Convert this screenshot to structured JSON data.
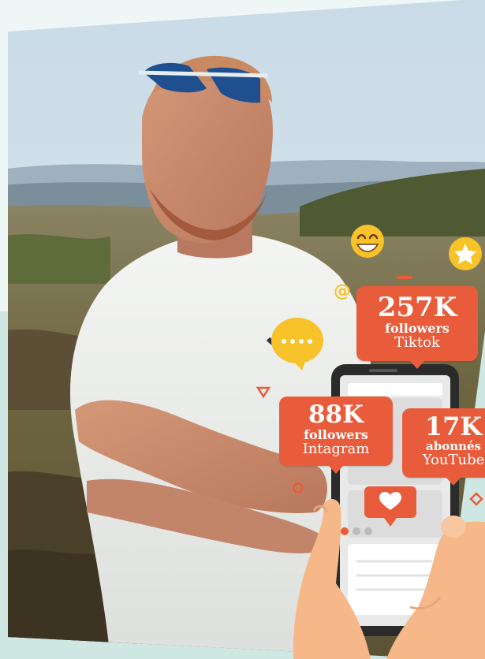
{
  "stats": {
    "tiktok": {
      "count": "257K",
      "unit": "followers",
      "network": "Tiktok"
    },
    "instagram": {
      "count": "88K",
      "unit": "followers",
      "network": "Intagram"
    },
    "youtube": {
      "count": "17K",
      "unit": "abonnés",
      "network": "YouTube"
    }
  },
  "icons": {
    "smiley": "smiley-emoji-icon",
    "star": "star-icon",
    "at": "at-sign-icon",
    "chat": "chat-bubble-icon",
    "heart": "heart-icon",
    "triangle": "triangle-icon",
    "circle": "circle-icon",
    "diamond": "diamond-icon"
  },
  "colors": {
    "accent": "#e85c3c",
    "yellow": "#f7c22a",
    "mint": "#cfe7e3",
    "phone": "#2b2b2b",
    "hand": "#f6b889"
  }
}
